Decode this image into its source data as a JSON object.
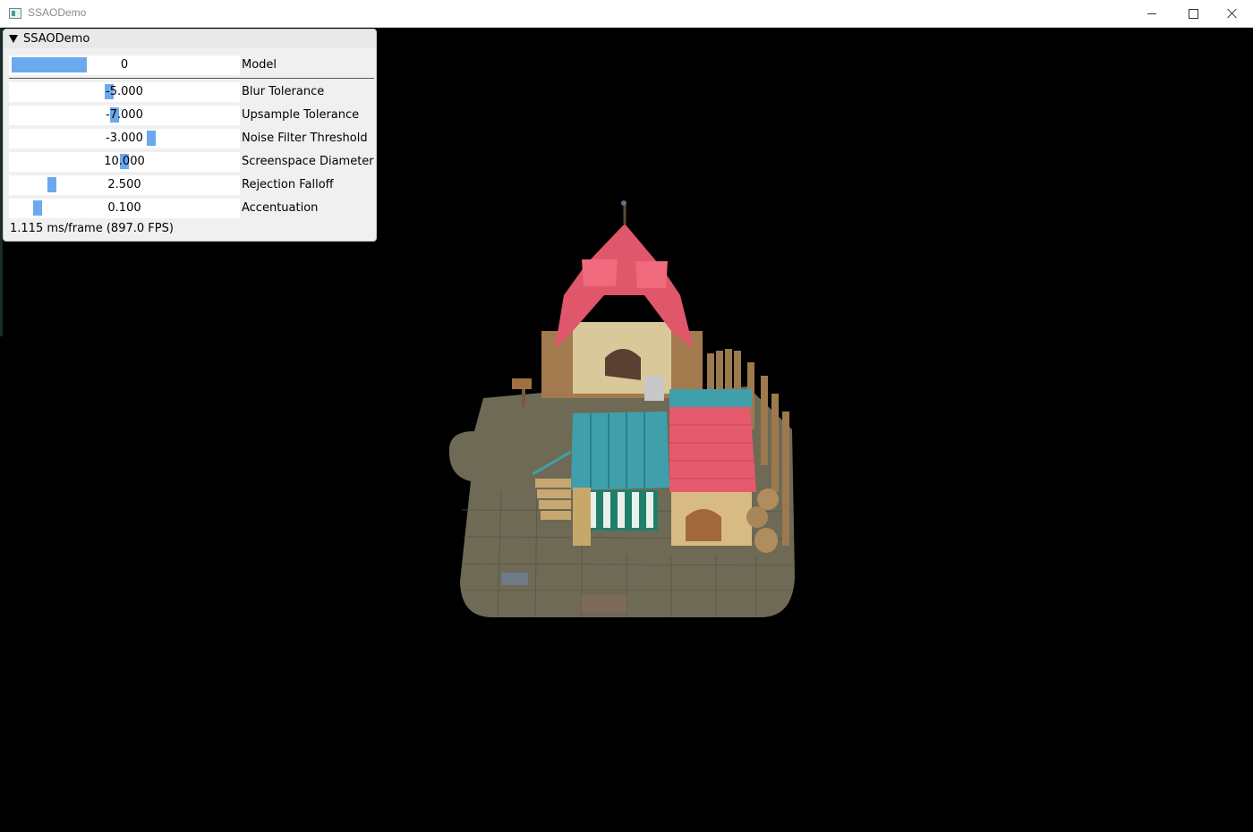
{
  "window": {
    "title": "SSAODemo",
    "controls": {
      "minimize_icon": "minimize-icon",
      "maximize_icon": "maximize-icon",
      "close_icon": "close-icon"
    }
  },
  "panel": {
    "title": "SSAODemo",
    "collapse_icon": "collapse-triangle-icon",
    "controls": [
      {
        "label": "Model",
        "value": "0",
        "kind": "slider-int",
        "fill_fraction": 0.33
      },
      {
        "label": "Blur Tolerance",
        "value": "-5.000",
        "kind": "slider-float"
      },
      {
        "label": "Upsample Tolerance",
        "value": "-7.000",
        "kind": "slider-float"
      },
      {
        "label": "Noise Filter Threshold",
        "value": "-3.000",
        "kind": "slider-float"
      },
      {
        "label": "Screenspace Diameter",
        "value": "10.000",
        "kind": "slider-float"
      },
      {
        "label": "Rejection Falloff",
        "value": "2.500",
        "kind": "slider-float"
      },
      {
        "label": "Accentuation",
        "value": "0.100",
        "kind": "slider-float"
      }
    ],
    "fps_text": "1.115 ms/frame (897.0 FPS)"
  },
  "colors": {
    "accent": "#6aa9ee",
    "panel_bg": "#f0f0f0",
    "viewport_bg": "#000000"
  },
  "scene": {
    "description_icon": "3d-house-model"
  }
}
